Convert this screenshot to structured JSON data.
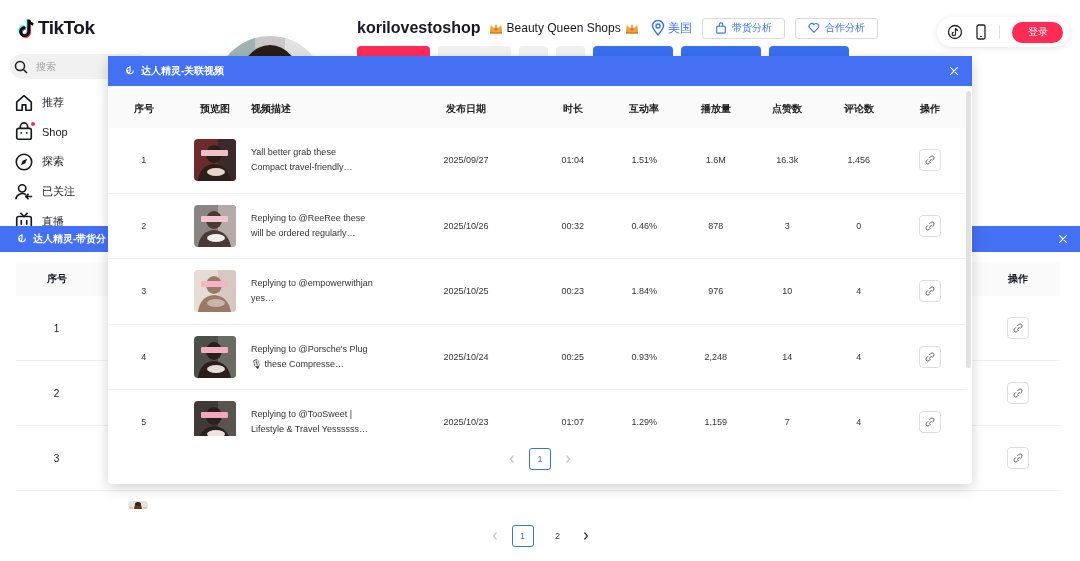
{
  "site": {
    "logo": "TikTok",
    "search_placeholder": "搜索",
    "login_button": "登录"
  },
  "nav": [
    {
      "label": "推荐",
      "badge": false
    },
    {
      "label": "Shop",
      "badge": true
    },
    {
      "label": "探索",
      "badge": false
    },
    {
      "label": "已关注",
      "badge": false
    },
    {
      "label": "直播",
      "badge": false
    }
  ],
  "profile": {
    "username": "korilovestoshop",
    "shop_name": "Beauty Queen Shops",
    "region": "美国",
    "buttons": [
      {
        "label": "带货分析"
      },
      {
        "label": "合作分析"
      }
    ],
    "hidden_actions": [
      {
        "kind": "primary"
      },
      {
        "kind": "grey"
      },
      {
        "kind": "grey-small"
      },
      {
        "kind": "grey-small"
      },
      {
        "kind": "blue"
      },
      {
        "kind": "blue"
      },
      {
        "kind": "blue"
      }
    ]
  },
  "back_dialog": {
    "title": "达人精灵-带货分",
    "columns": [
      "序号",
      "操作"
    ],
    "rows": [
      {
        "index": "1"
      },
      {
        "index": "2"
      },
      {
        "index": "3"
      }
    ],
    "partial_row": {
      "preview": {
        "kind": "picture"
      }
    },
    "pagination": {
      "prev_disabled": true,
      "next_disabled": false,
      "pages": [
        {
          "label": "1",
          "selected": true
        },
        {
          "label": "2",
          "selected": false
        }
      ]
    }
  },
  "dialog": {
    "title": "达人精灵-关联视频",
    "columns": [
      "序号",
      "预览图",
      "视频描述",
      "发布日期",
      "时长",
      "互动率",
      "播放量",
      "点赞数",
      "评论数",
      "操作"
    ],
    "rows": [
      {
        "index": "1",
        "preview": {
          "kind": "picture"
        },
        "description": "Yall better grab these Compact travel-friendly…",
        "date": "2025/09/27",
        "duration": "01:04",
        "engagement": "1.51%",
        "views": "1.6M",
        "likes": "16.3k",
        "comments": "1,456"
      },
      {
        "index": "2",
        "preview": {
          "kind": "picture"
        },
        "description": "Replying to @ReeRee these will be ordered regularly…",
        "date": "2025/10/26",
        "duration": "00:32",
        "engagement": "0.46%",
        "views": "878",
        "likes": "3",
        "comments": "0"
      },
      {
        "index": "3",
        "preview": {
          "kind": "picture"
        },
        "description": "Replying to @empowerwithjan yes…",
        "date": "2025/10/25",
        "duration": "00:23",
        "engagement": "1.84%",
        "views": "976",
        "likes": "10",
        "comments": "4"
      },
      {
        "index": "4",
        "preview": {
          "kind": "picture"
        },
        "description": "Replying to @Porsche's Plug 🎙 these Compresse…",
        "date": "2025/10/24",
        "duration": "00:25",
        "engagement": "0.93%",
        "views": "2,248",
        "likes": "14",
        "comments": "4"
      },
      {
        "index": "5",
        "preview": {
          "kind": "picture"
        },
        "description": "Replying to @TooSweet | Lifestyle & Travel Yessssss…",
        "date": "2025/10/23",
        "duration": "01:07",
        "engagement": "1.29%",
        "views": "1,159",
        "likes": "7",
        "comments": "4"
      }
    ],
    "pagination": {
      "prev_disabled": true,
      "next_disabled": true,
      "pages": [
        {
          "label": "1",
          "selected": true
        }
      ]
    }
  }
}
